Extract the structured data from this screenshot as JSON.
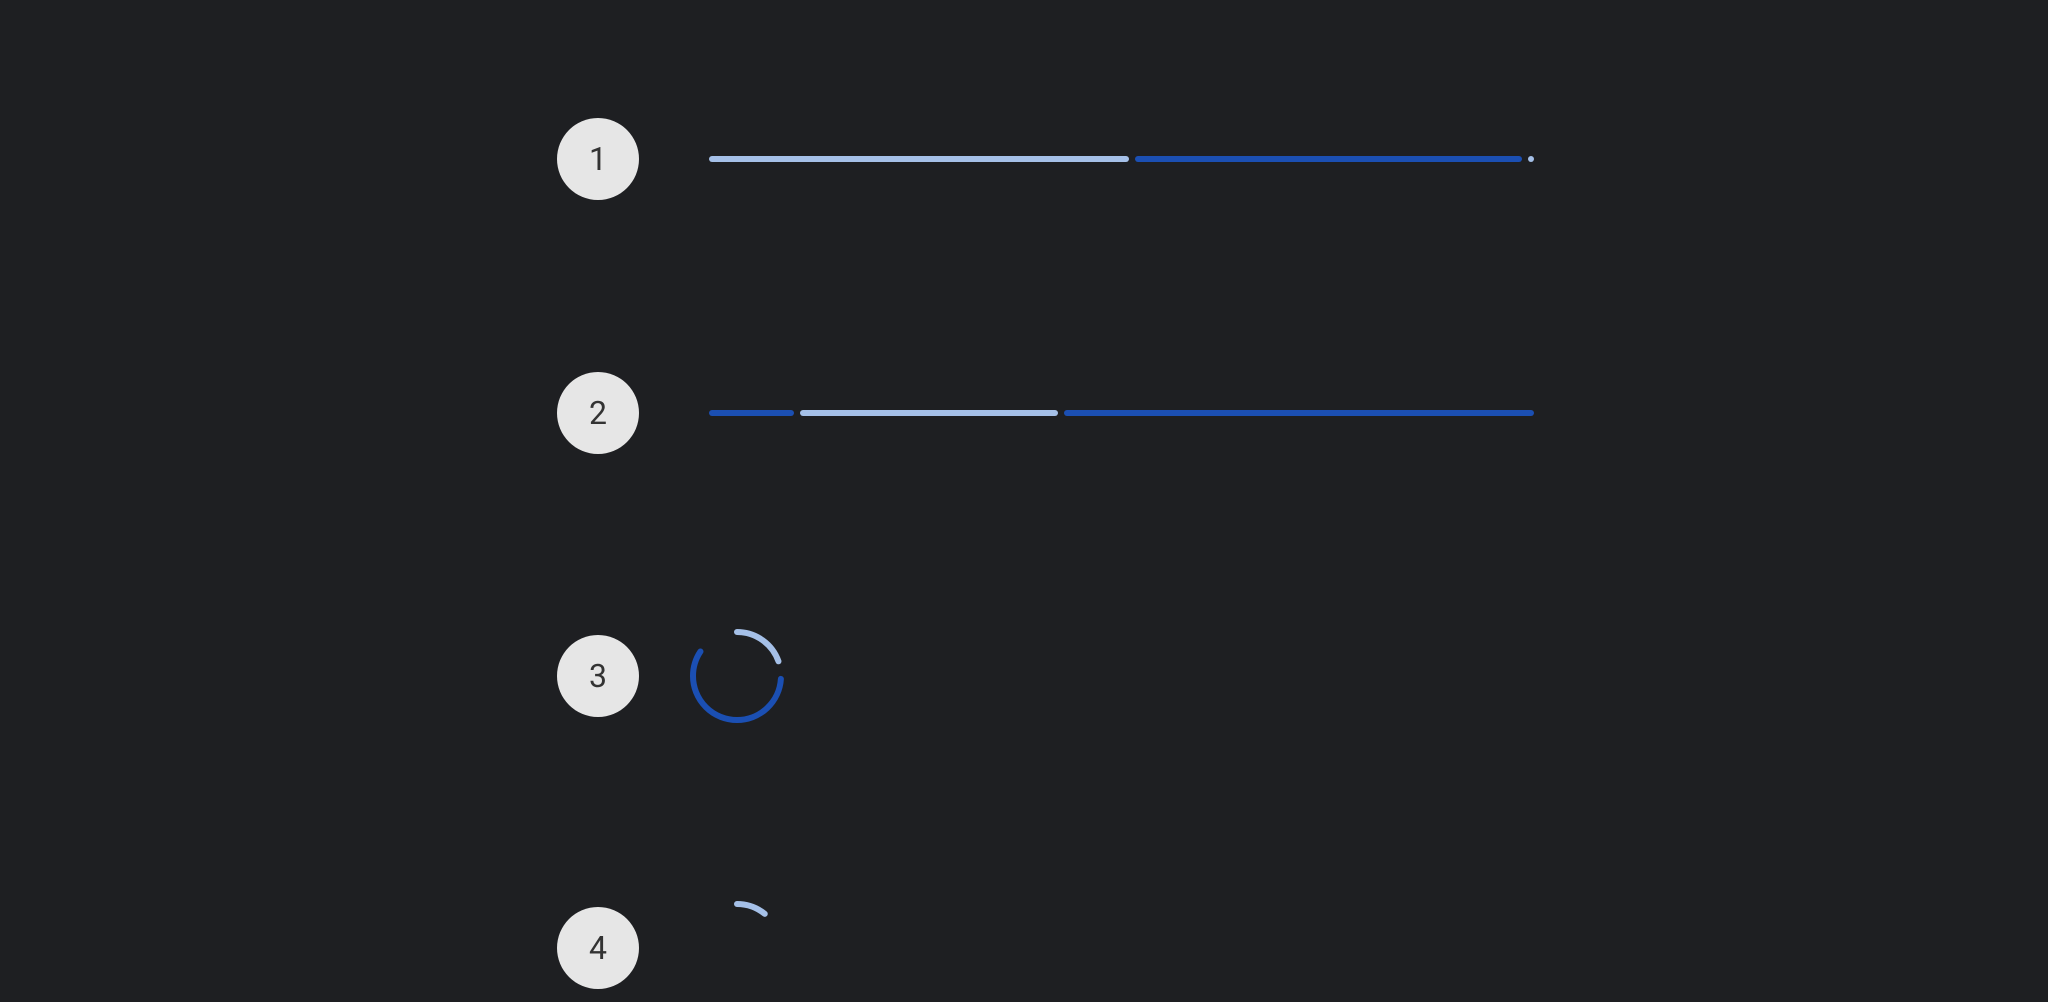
{
  "items": [
    {
      "number": "1",
      "type": "linear-determinate",
      "colors": {
        "primary": "#1b4fb3",
        "track": "#a5c0e8"
      }
    },
    {
      "number": "2",
      "type": "linear-indeterminate",
      "colors": {
        "primary": "#1b4fb3",
        "track": "#a5c0e8"
      }
    },
    {
      "number": "3",
      "type": "circular-determinate",
      "colors": {
        "primary": "#1b4fb3",
        "track": "#a5c0e8"
      }
    },
    {
      "number": "4",
      "type": "circular-indeterminate",
      "colors": {
        "primary": "#a5c0e8"
      }
    }
  ]
}
